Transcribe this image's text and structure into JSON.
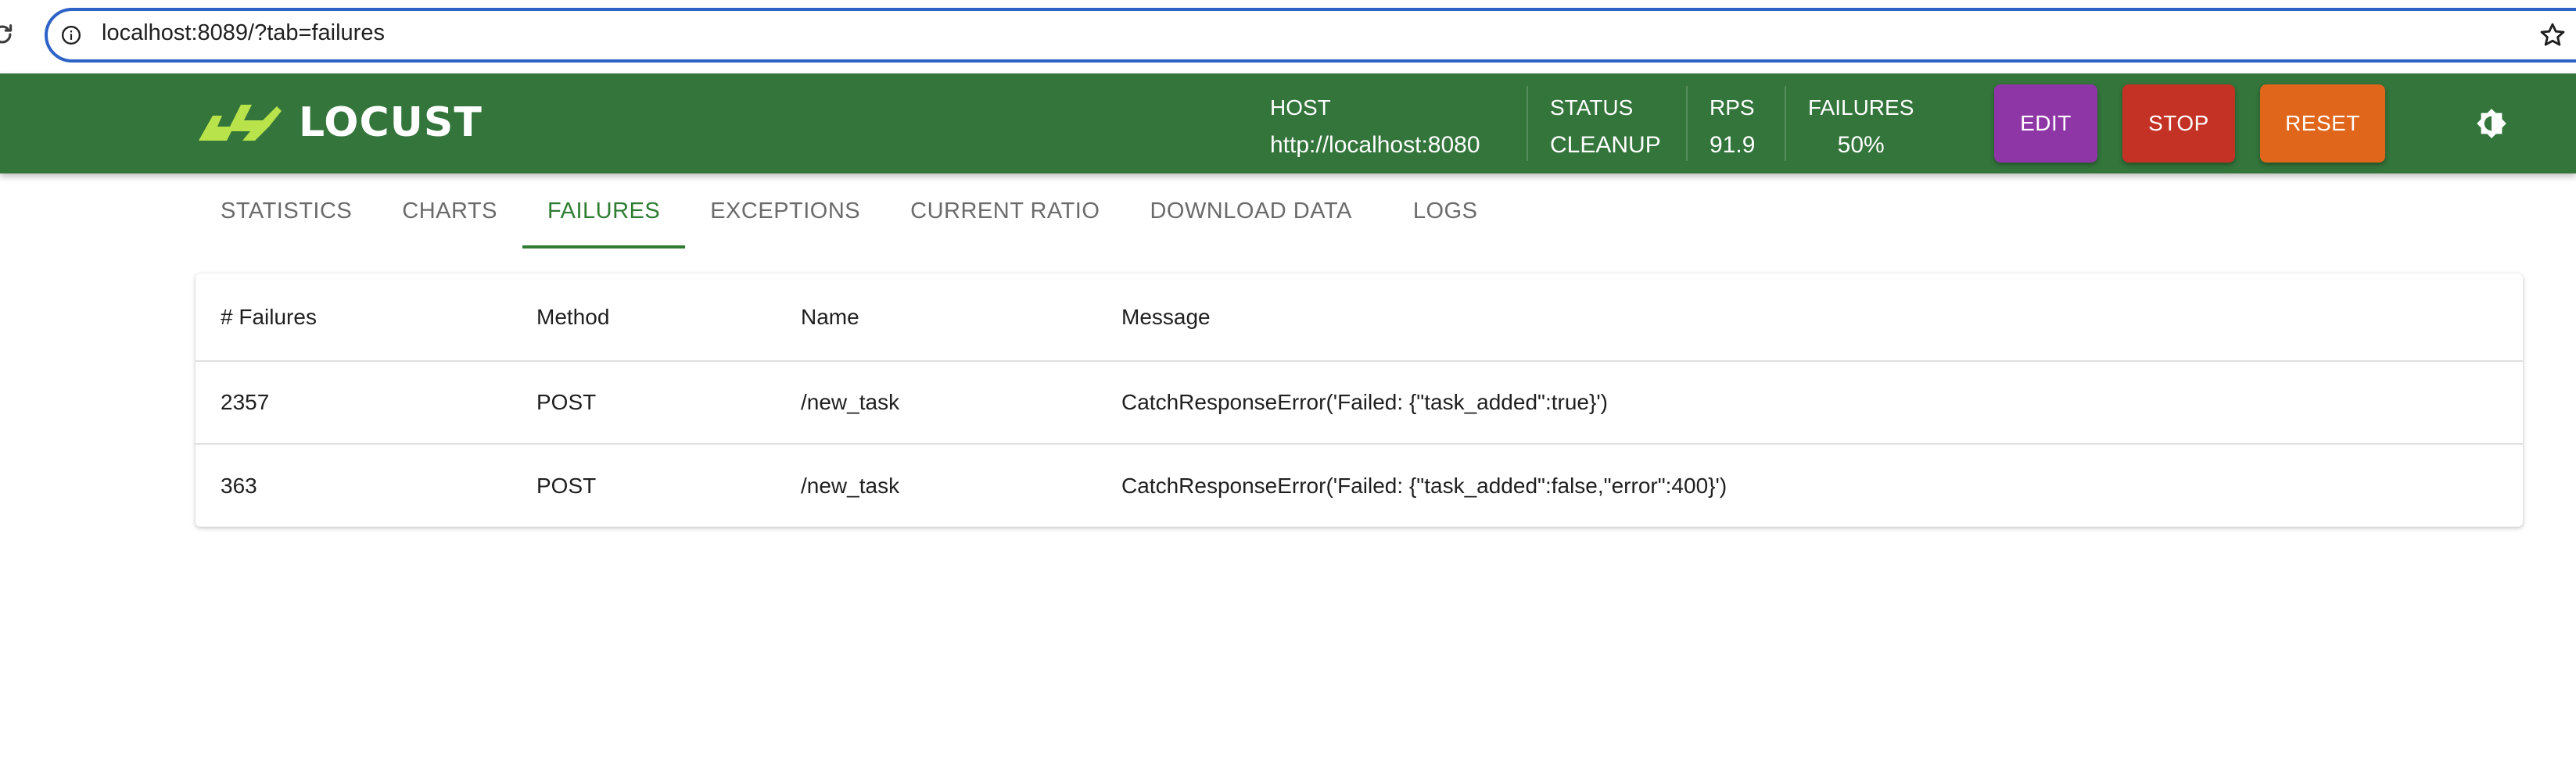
{
  "browser": {
    "url": "localhost:8089/?tab=failures"
  },
  "header": {
    "logo_text": "LOCUST",
    "stats": {
      "host": {
        "label": "HOST",
        "value": "http://localhost:8080"
      },
      "status": {
        "label": "STATUS",
        "value": "CLEANUP"
      },
      "rps": {
        "label": "RPS",
        "value": "91.9"
      },
      "failures": {
        "label": "FAILURES",
        "value": "50%"
      }
    },
    "buttons": {
      "edit": "EDIT",
      "stop": "STOP",
      "reset": "RESET"
    },
    "colors": {
      "header_bg": "#33753b",
      "edit": "#8f36a7",
      "stop": "#c43225",
      "reset": "#e0661c",
      "logo_accent": "#b9e34a"
    }
  },
  "tabs": [
    {
      "label": "STATISTICS",
      "active": false
    },
    {
      "label": "CHARTS",
      "active": false
    },
    {
      "label": "FAILURES",
      "active": true
    },
    {
      "label": "EXCEPTIONS",
      "active": false
    },
    {
      "label": "CURRENT RATIO",
      "active": false
    },
    {
      "label": "DOWNLOAD DATA",
      "active": false
    },
    {
      "label": "LOGS",
      "active": false
    }
  ],
  "failures_table": {
    "columns": [
      "# Failures",
      "Method",
      "Name",
      "Message"
    ],
    "rows": [
      [
        "2357",
        "POST",
        "/new_task",
        "CatchResponseError('Failed: {\"task_added\":true}')"
      ],
      [
        "363",
        "POST",
        "/new_task",
        "CatchResponseError('Failed: {\"task_added\":false,\"error\":400}')"
      ]
    ]
  }
}
